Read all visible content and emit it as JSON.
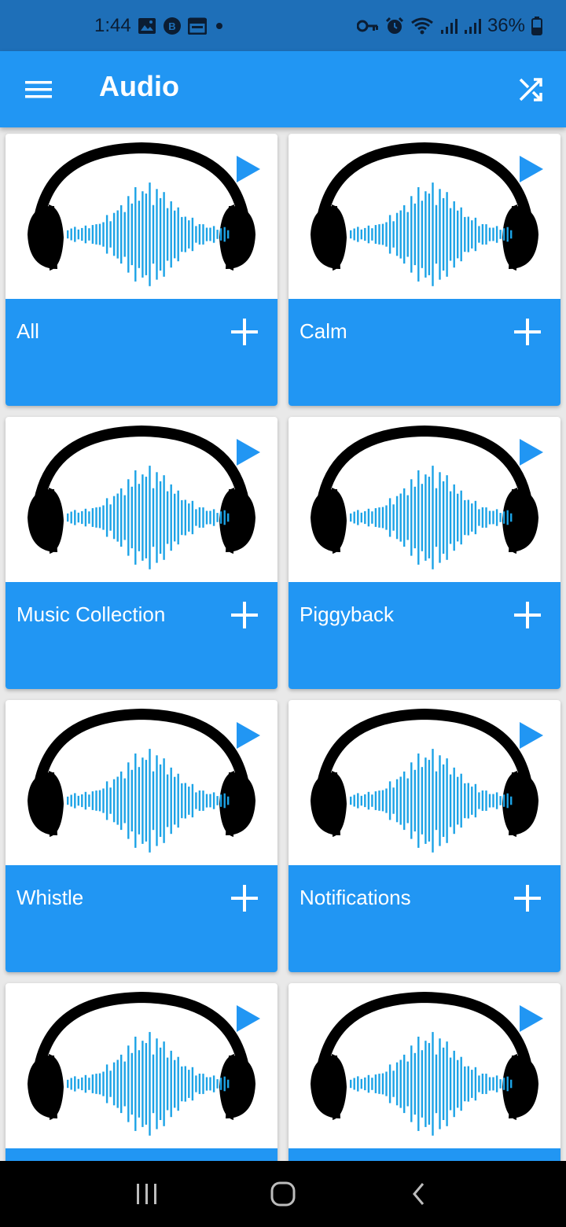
{
  "status_bar": {
    "time": "1:44",
    "battery_percent": "36%",
    "icons": [
      "image-icon",
      "whatsapp-business-icon",
      "calendar-icon",
      "dot-icon",
      "key-icon",
      "alarm-icon",
      "wifi-icon",
      "signal-icon",
      "signal-icon",
      "battery-icon"
    ]
  },
  "app_bar": {
    "title": "Audio",
    "menu_icon": "hamburger-menu-icon",
    "shuffle_icon": "shuffle-icon",
    "background": "#2196f3"
  },
  "colors": {
    "accent": "#2196f3",
    "waveform": "#1ca3e6",
    "status_bar": "#1e6fb8"
  },
  "categories": [
    {
      "label": "All"
    },
    {
      "label": "Calm"
    },
    {
      "label": "Music Collection"
    },
    {
      "label": "Piggyback"
    },
    {
      "label": "Whistle"
    },
    {
      "label": "Notifications"
    },
    {
      "label": ""
    },
    {
      "label": ""
    }
  ],
  "nav_bar": {
    "icons": [
      "recent-apps-icon",
      "home-icon",
      "back-icon"
    ]
  }
}
